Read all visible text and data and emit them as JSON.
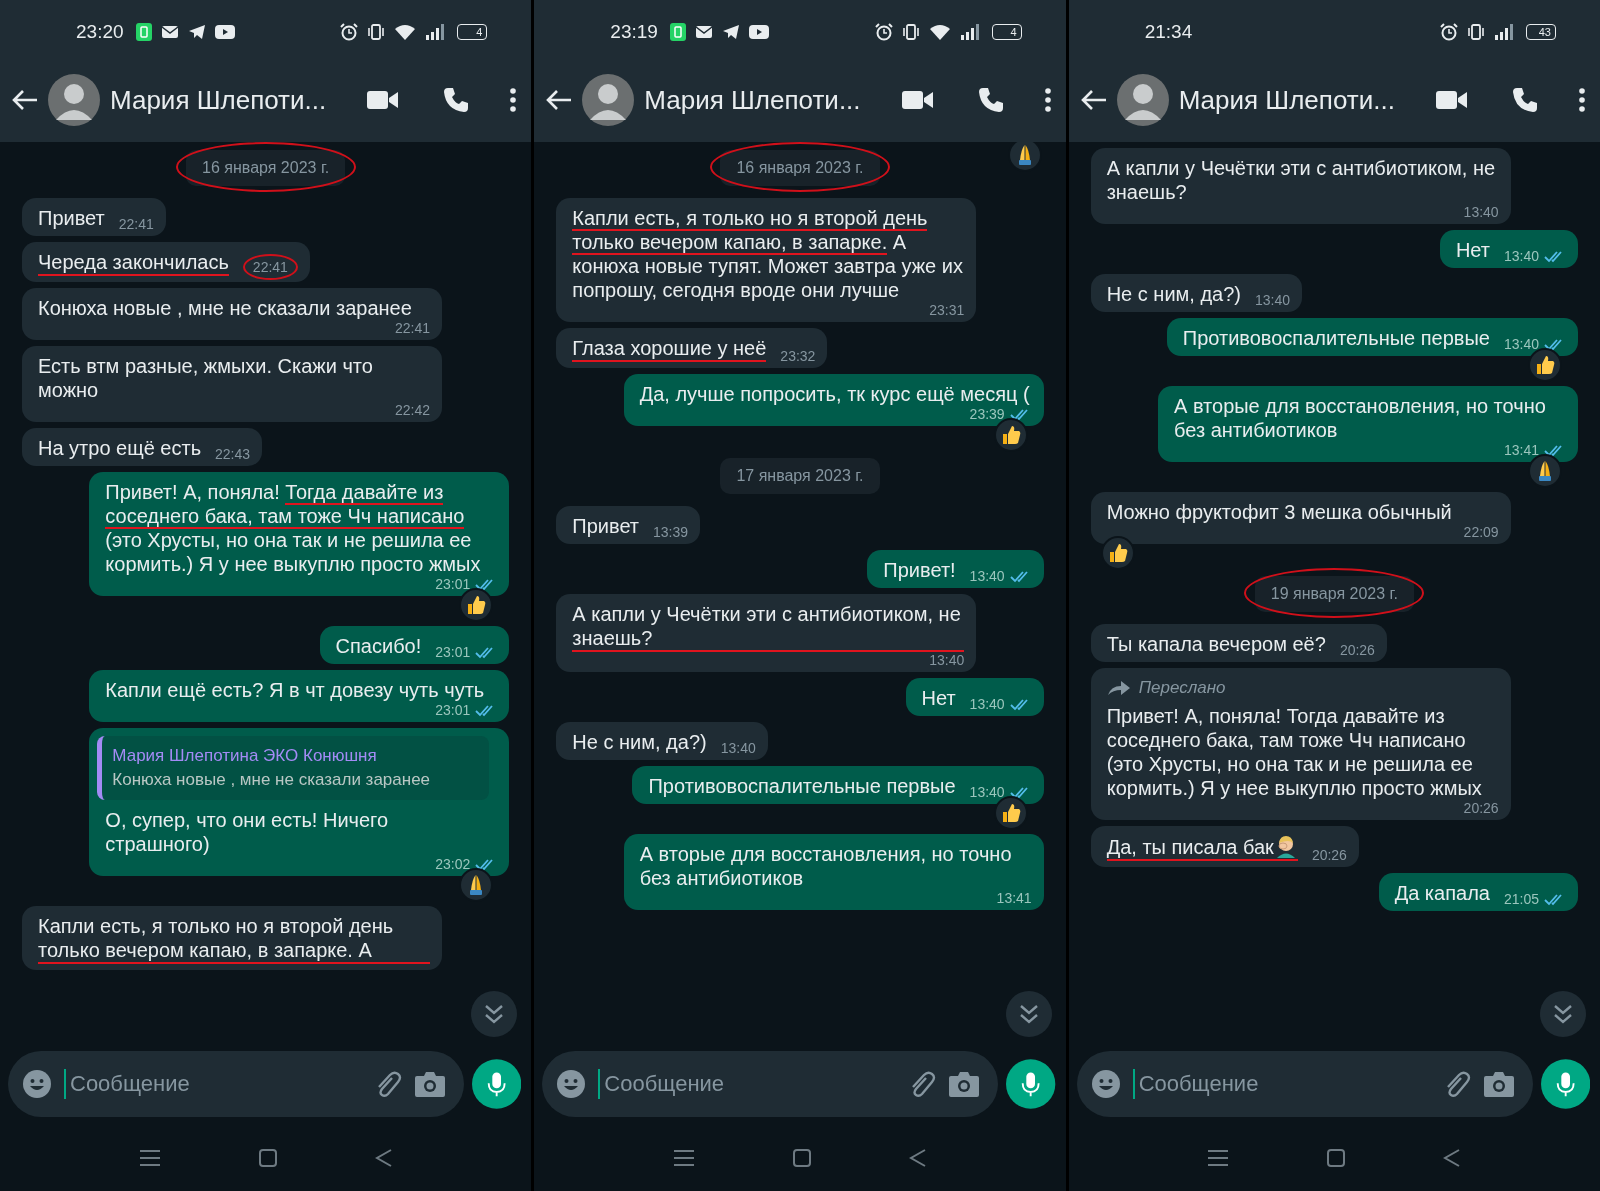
{
  "panels": [
    {
      "status": {
        "time": "23:20",
        "battery": "4",
        "notification_icons": true,
        "wifi": true
      },
      "header": {
        "name": "Мария Шлепоти..."
      },
      "scroll_button": true,
      "messages": [
        {
          "kind": "date",
          "text": "16 января 2023 г.",
          "circled": true
        },
        {
          "kind": "in",
          "text": "Привет",
          "time": "22:41"
        },
        {
          "kind": "in",
          "text": "Череда закончилась",
          "time": "22:41",
          "underlined": true,
          "time_circled": true
        },
        {
          "kind": "in",
          "text": "Конюха новые , мне не сказали заранее",
          "time": "22:41"
        },
        {
          "kind": "in",
          "text": "Есть втм разные, жмыхи. Скажи что можно",
          "time": "22:42"
        },
        {
          "kind": "in",
          "text": "На утро ещё есть",
          "time": "22:43"
        },
        {
          "kind": "out",
          "parts": [
            {
              "text": "Привет! А, поняла! ",
              "underlined": false
            },
            {
              "text": "Тогда давайте из соседнего бака, там тоже Чч написано",
              "underlined": true
            },
            {
              "text": " (это Хрусты, но она так и не решила ее кормить.) Я у нее выкуплю просто жмых",
              "underlined": false
            }
          ],
          "time": "23:01",
          "read": true,
          "reaction": {
            "kind": "thumbs_up"
          }
        },
        {
          "kind": "out",
          "text": "Спасибо!",
          "time": "23:01",
          "read": true
        },
        {
          "kind": "out",
          "text": "Капли ещё есть? Я в чт довезу чуть чуть",
          "time": "23:01",
          "read": true
        },
        {
          "kind": "out",
          "quote": {
            "author": "Мария Шлепотина ЭКО Конюшня",
            "text": "Конюха новые , мне не сказали заранее"
          },
          "text": "О, супер, что они есть! Ничего страшного)",
          "time": "23:02",
          "read": true,
          "reaction": {
            "kind": "pray"
          }
        },
        {
          "kind": "in",
          "text": "Капли есть, я только но я второй день только вечером капаю, в запарке. А",
          "underlined": true
        }
      ],
      "input": {
        "placeholder": "Сообщение"
      }
    },
    {
      "status": {
        "time": "23:19",
        "battery": "4",
        "notification_icons": true,
        "wifi": true
      },
      "header": {
        "name": "Мария Шлепоти..."
      },
      "scroll_button": true,
      "top_reaction": {
        "kind": "pray"
      },
      "messages": [
        {
          "kind": "date",
          "text": "16 января 2023 г.",
          "circled": true
        },
        {
          "kind": "in",
          "parts": [
            {
              "text": "Капли есть, я только но я второй день только вечером капаю, в запарке.",
              "underlined": true
            },
            {
              "text": " А конюха новые тупят. Может завтра уже их попрошу, сегодня вроде они лучше",
              "underlined": false
            }
          ],
          "time": "23:31"
        },
        {
          "kind": "in",
          "text": "Глаза хорошие у неё",
          "time": "23:32",
          "underlined": true
        },
        {
          "kind": "out",
          "text": "Да, лучше попросить, тк курс ещё месяц (",
          "time": "23:39",
          "read": true,
          "reaction": {
            "kind": "thumbs_up"
          }
        },
        {
          "kind": "date",
          "text": "17 января 2023 г.",
          "circled": false
        },
        {
          "kind": "in",
          "text": "Привет",
          "time": "13:39"
        },
        {
          "kind": "out",
          "text": "Привет!",
          "time": "13:40",
          "read": true
        },
        {
          "kind": "in",
          "text": "А капли у Чечётки эти с антибиотиком, не знаешь?",
          "time": "13:40",
          "underlined": true
        },
        {
          "kind": "out",
          "text": "Нет",
          "time": "13:40",
          "read": true
        },
        {
          "kind": "in",
          "text": "Не с ним, да?)",
          "time": "13:40"
        },
        {
          "kind": "out",
          "text": "Противовоспалительные первые",
          "time": "13:40",
          "read": true,
          "reaction": {
            "kind": "thumbs_up"
          }
        },
        {
          "kind": "out",
          "text": "А вторые для восстановления, но точно без антибиотиков",
          "time": "13:41"
        }
      ],
      "input": {
        "placeholder": "Сообщение"
      }
    },
    {
      "status": {
        "time": "21:34",
        "battery": "43",
        "notification_icons": false,
        "wifi": false
      },
      "header": {
        "name": "Мария Шлепоти..."
      },
      "scroll_button": true,
      "messages": [
        {
          "kind": "in",
          "text": "А капли у Чечётки эти с антибиотиком, не знаешь?",
          "time": "13:40"
        },
        {
          "kind": "out",
          "text": "Нет",
          "time": "13:40",
          "read": true
        },
        {
          "kind": "in",
          "text": "Не с ним, да?)",
          "time": "13:40"
        },
        {
          "kind": "out",
          "text": "Противовоспалительные первые",
          "time": "13:40",
          "read": true,
          "reaction": {
            "kind": "thumbs_up"
          }
        },
        {
          "kind": "out",
          "text": "А вторые для восстановления, но точно без антибиотиков",
          "time": "13:41",
          "read": true,
          "reaction": {
            "kind": "pray"
          }
        },
        {
          "kind": "in",
          "text": "Можно фруктофит 3 мешка обычный",
          "time": "22:09",
          "reaction": {
            "kind": "thumbs_up"
          }
        },
        {
          "kind": "date",
          "text": "19 января 2023 г.",
          "circled": true
        },
        {
          "kind": "in",
          "text": "Ты капала вечером её?",
          "time": "20:26"
        },
        {
          "kind": "in",
          "forwarded": "Переслано",
          "text": "Привет! А, поняла! Тогда давайте из соседнего бака, там тоже Чч написано (это Хрусты, но она так и не решила ее кормить.) Я у нее выкуплю просто жмых",
          "time": "20:26"
        },
        {
          "kind": "in",
          "text": "Да, ты писала бак",
          "emoji": {
            "kind": "facepalm"
          },
          "time": "20:26",
          "underlined": true
        },
        {
          "kind": "out",
          "text": "Да капала",
          "time": "21:05",
          "read": true
        }
      ],
      "input": {
        "placeholder": "Сообщение"
      }
    }
  ]
}
